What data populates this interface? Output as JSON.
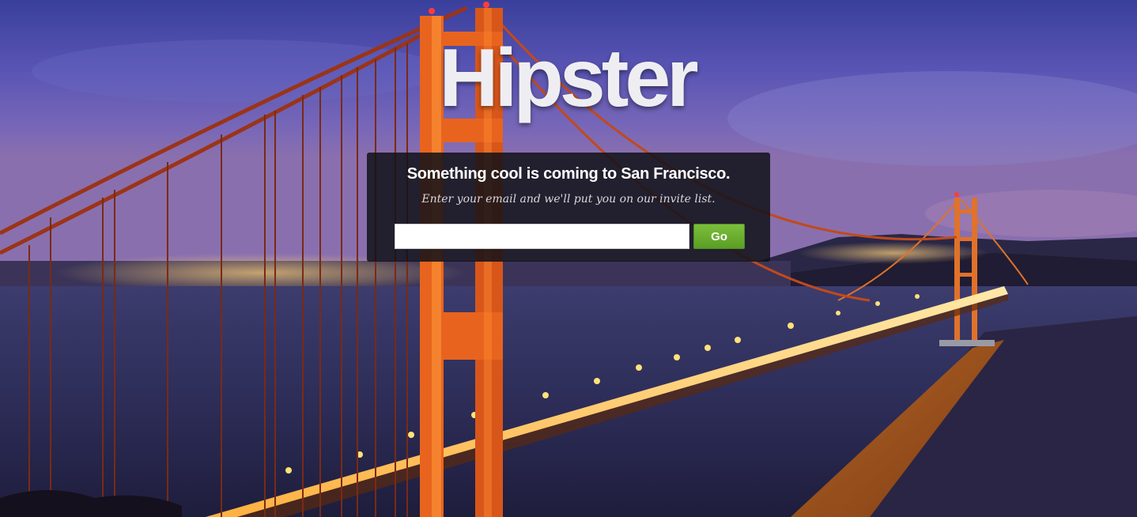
{
  "brand": {
    "name": "Hipster"
  },
  "signup": {
    "headline": "Something cool is coming to San Francisco.",
    "subline": "Enter your email and we'll put you on our invite list.",
    "email_value": "",
    "email_placeholder": "",
    "submit_label": "Go"
  },
  "background": {
    "icon": "golden-gate-bridge-night-photo"
  },
  "colors": {
    "accent_green": "#6aaf2f",
    "box_background": "#121218",
    "brand_text": "#eeeef2"
  }
}
